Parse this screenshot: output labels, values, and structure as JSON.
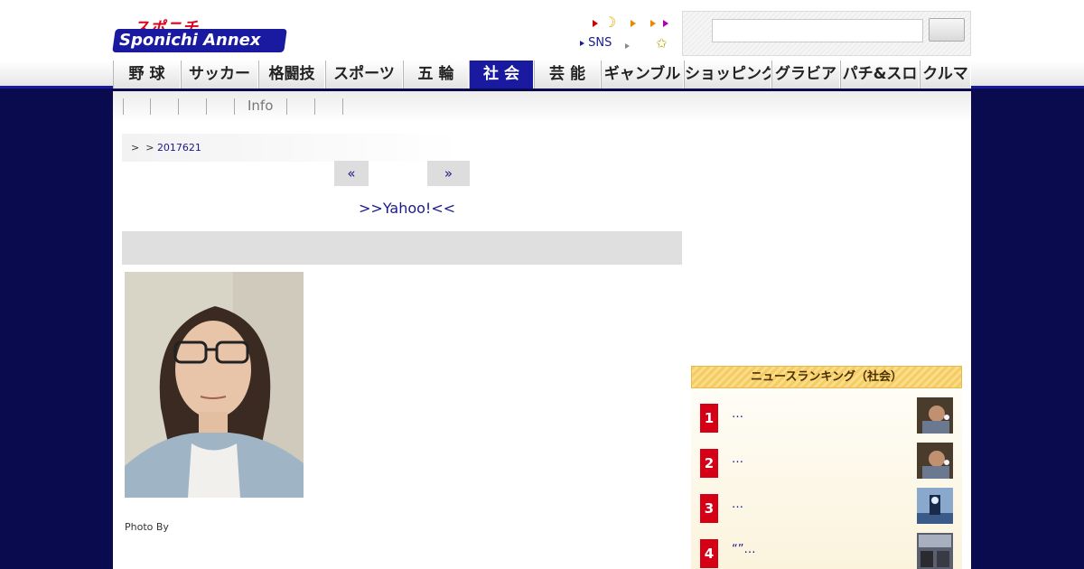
{
  "header": {
    "logo_top": "スポニチ",
    "logo_bottom": "Sponichi Annex",
    "sns_label": "SNS",
    "search": {
      "placeholder": ""
    },
    "colors": {
      "brand_blue": "#1a1aa0",
      "brand_red": "#e0001b",
      "navy_bg": "#0a0a4e"
    }
  },
  "nav": {
    "items": [
      {
        "label": "野 球",
        "active": false
      },
      {
        "label": "サッカー",
        "active": false
      },
      {
        "label": "格闘技",
        "active": false
      },
      {
        "label": "スポーツ",
        "active": false
      },
      {
        "label": "五 輪",
        "active": false
      },
      {
        "label": "社 会",
        "active": true
      },
      {
        "label": "芸 能",
        "active": false
      },
      {
        "label": "ギャンブル",
        "active": false
      },
      {
        "label": "ショッピング",
        "active": false
      },
      {
        "label": "グラビア",
        "active": false
      },
      {
        "label": "パチ&スロ",
        "active": false
      },
      {
        "label": "クルマ",
        "active": false
      }
    ]
  },
  "subnav": {
    "info_label": "Info"
  },
  "breadcrumb": {
    "sep1": ">",
    "sep2": ">",
    "date": "2017621"
  },
  "pager": {
    "prev": "«",
    "next": "»"
  },
  "yahoo_link": ">>Yahoo!<<",
  "photo": {
    "credit": "Photo By"
  },
  "ranking": {
    "title": "ニュースランキング（社会）",
    "items": [
      {
        "rank": "1",
        "text": "…"
      },
      {
        "rank": "2",
        "text": "…"
      },
      {
        "rank": "3",
        "text": "…"
      },
      {
        "rank": "4",
        "text": "“”…"
      }
    ]
  }
}
